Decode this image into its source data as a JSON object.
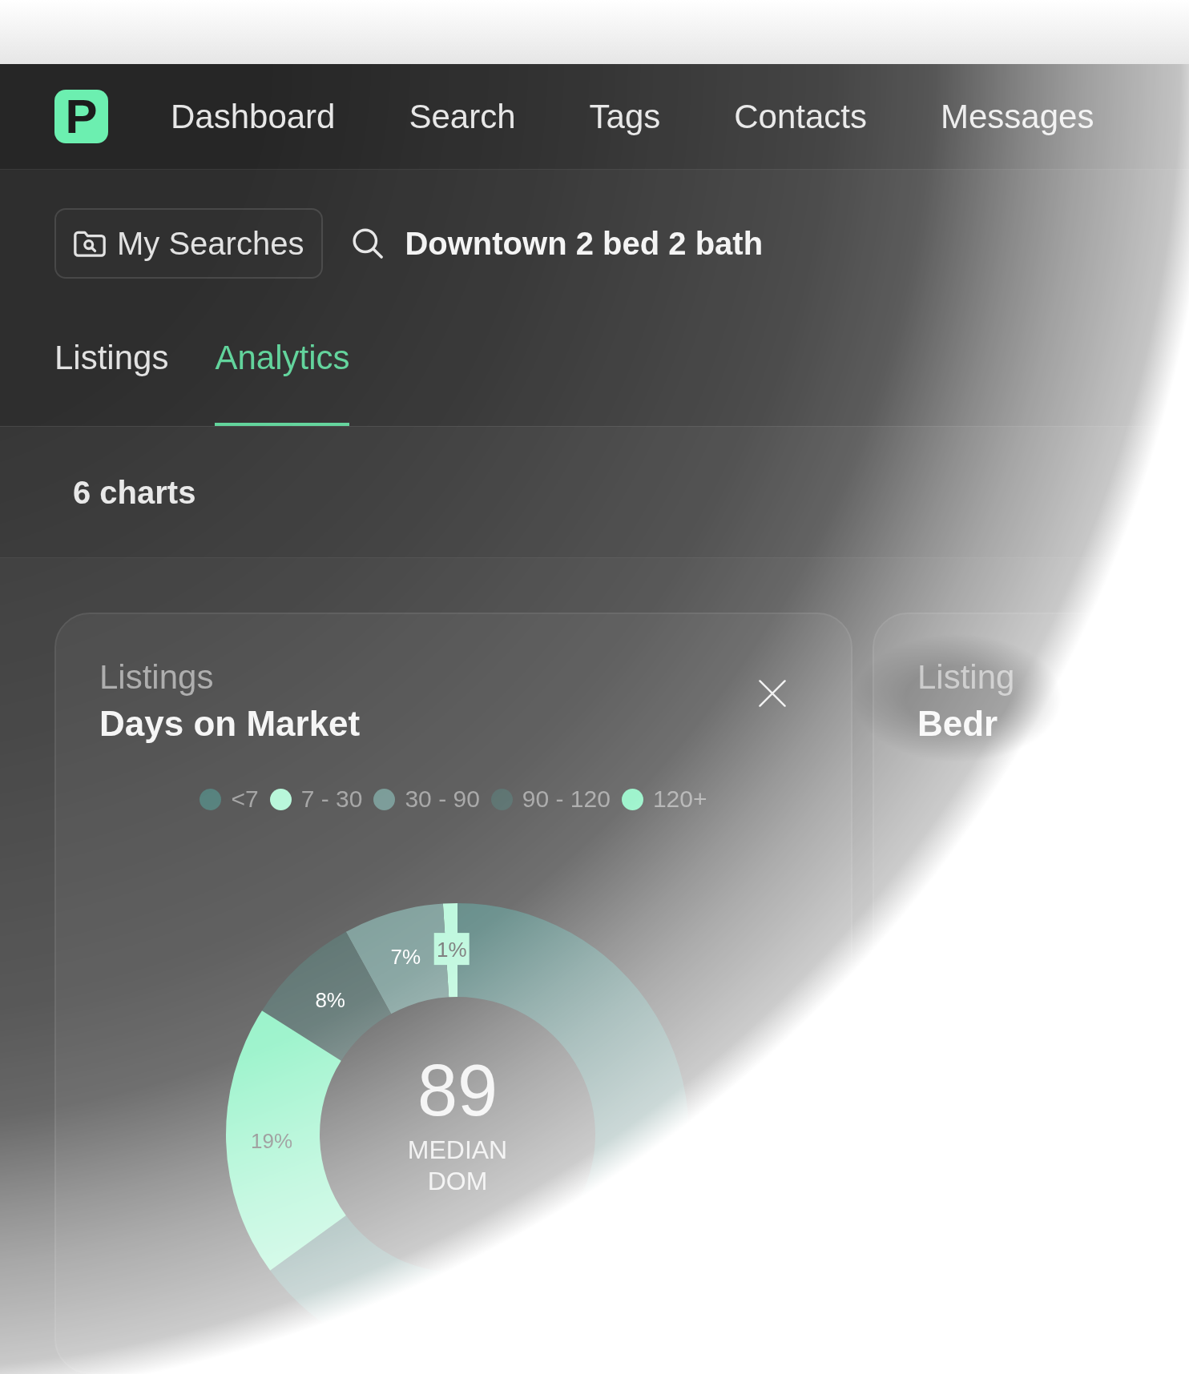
{
  "logo": {
    "letter": "P"
  },
  "nav": [
    "Dashboard",
    "Search",
    "Tags",
    "Contacts",
    "Messages"
  ],
  "my_searches_button": {
    "label": "My Searches"
  },
  "search": {
    "value": "Downtown 2 bed 2 bath"
  },
  "tabs": [
    {
      "label": "Listings",
      "selected": false
    },
    {
      "label": "Analytics",
      "selected": true
    }
  ],
  "chart_count": "6 charts",
  "cards": [
    {
      "subtitle": "Listings",
      "title": "Days on Market",
      "closable": true,
      "chart_data": {
        "type": "donut",
        "categories": [
          "<7",
          "7 - 30",
          "30 - 90",
          "90 - 120",
          "120+"
        ],
        "values": [
          65,
          1,
          7,
          8,
          19
        ],
        "colors": [
          "#467571",
          "#b0f6d6",
          "#6a8f8b",
          "#435d5a",
          "#84f0bf"
        ],
        "value_labels": [
          null,
          "1%",
          "7%",
          "8%",
          "19%"
        ]
      },
      "summary": {
        "value": "89",
        "label": "MEDIAN DOM"
      }
    },
    {
      "subtitle": "Listing",
      "title": "Bedr"
    }
  ]
}
